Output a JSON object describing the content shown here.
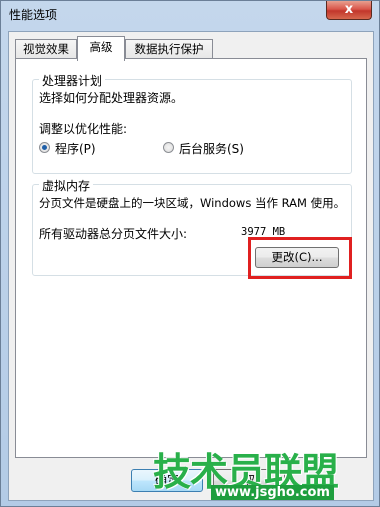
{
  "window": {
    "title": "性能选项",
    "close_glyph": "x"
  },
  "tabs": [
    {
      "label": "视觉效果",
      "active": false
    },
    {
      "label": "高级",
      "active": true
    },
    {
      "label": "数据执行保护",
      "active": false
    }
  ],
  "processor_group": {
    "title": "处理器计划",
    "description": "选择如何分配处理器资源。",
    "optimize_label": "调整以优化性能:",
    "options": [
      {
        "label": "程序(P)",
        "checked": true
      },
      {
        "label": "后台服务(S)",
        "checked": false
      }
    ]
  },
  "virtual_memory_group": {
    "title": "虚拟内存",
    "description": "分页文件是硬盘上的一块区域，Windows 当作 RAM 使用。",
    "total_label": "所有驱动器总分页文件大小:",
    "total_value": "3977 MB",
    "change_button": "更改(C)..."
  },
  "footer": {
    "ok_button_partial": "确定",
    "second_button_partial": "取"
  },
  "watermark": {
    "brand": "技术员联盟",
    "url": "www.jsgho.com"
  },
  "colors": {
    "highlight": "#e02020",
    "watermark_green": "#29b04a",
    "selected_radio": "#1f5fa8"
  }
}
